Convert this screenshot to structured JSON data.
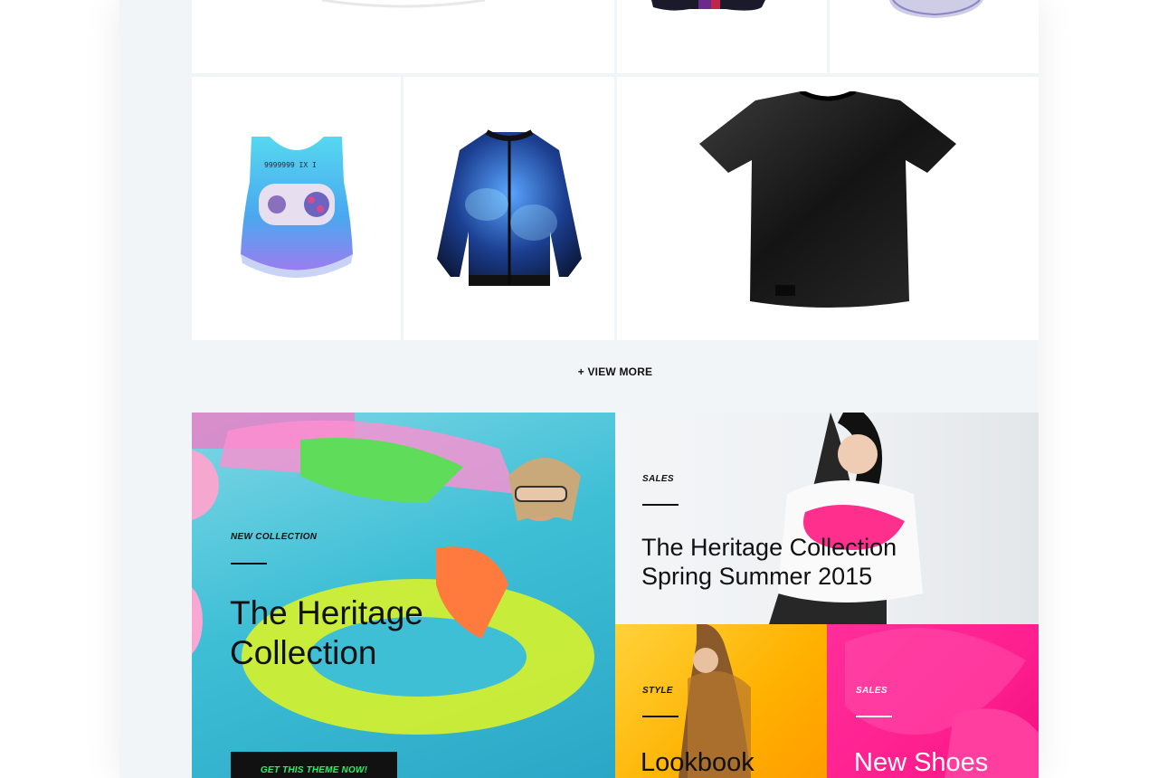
{
  "product_grid": {
    "view_more_label": "+ VIEW MORE"
  },
  "banners": {
    "main": {
      "label": "NEW COLLECTION",
      "title_line1": "The Heritage",
      "title_line2": "Collection",
      "cta": "GET THIS THEME NOW!"
    },
    "sales": {
      "label": "SALES",
      "title_line1": "The Heritage Collection",
      "title_line2": "Spring Summer 2015"
    },
    "style": {
      "label": "STYLE",
      "title": "Lookbook"
    },
    "shoes": {
      "label": "SALES",
      "title": "New Shoes"
    }
  },
  "colors": {
    "cta_text": "#22f266",
    "cta_bg": "#111111",
    "style_banner": "#ffb100",
    "shoes_banner": "#ff1f8f"
  }
}
